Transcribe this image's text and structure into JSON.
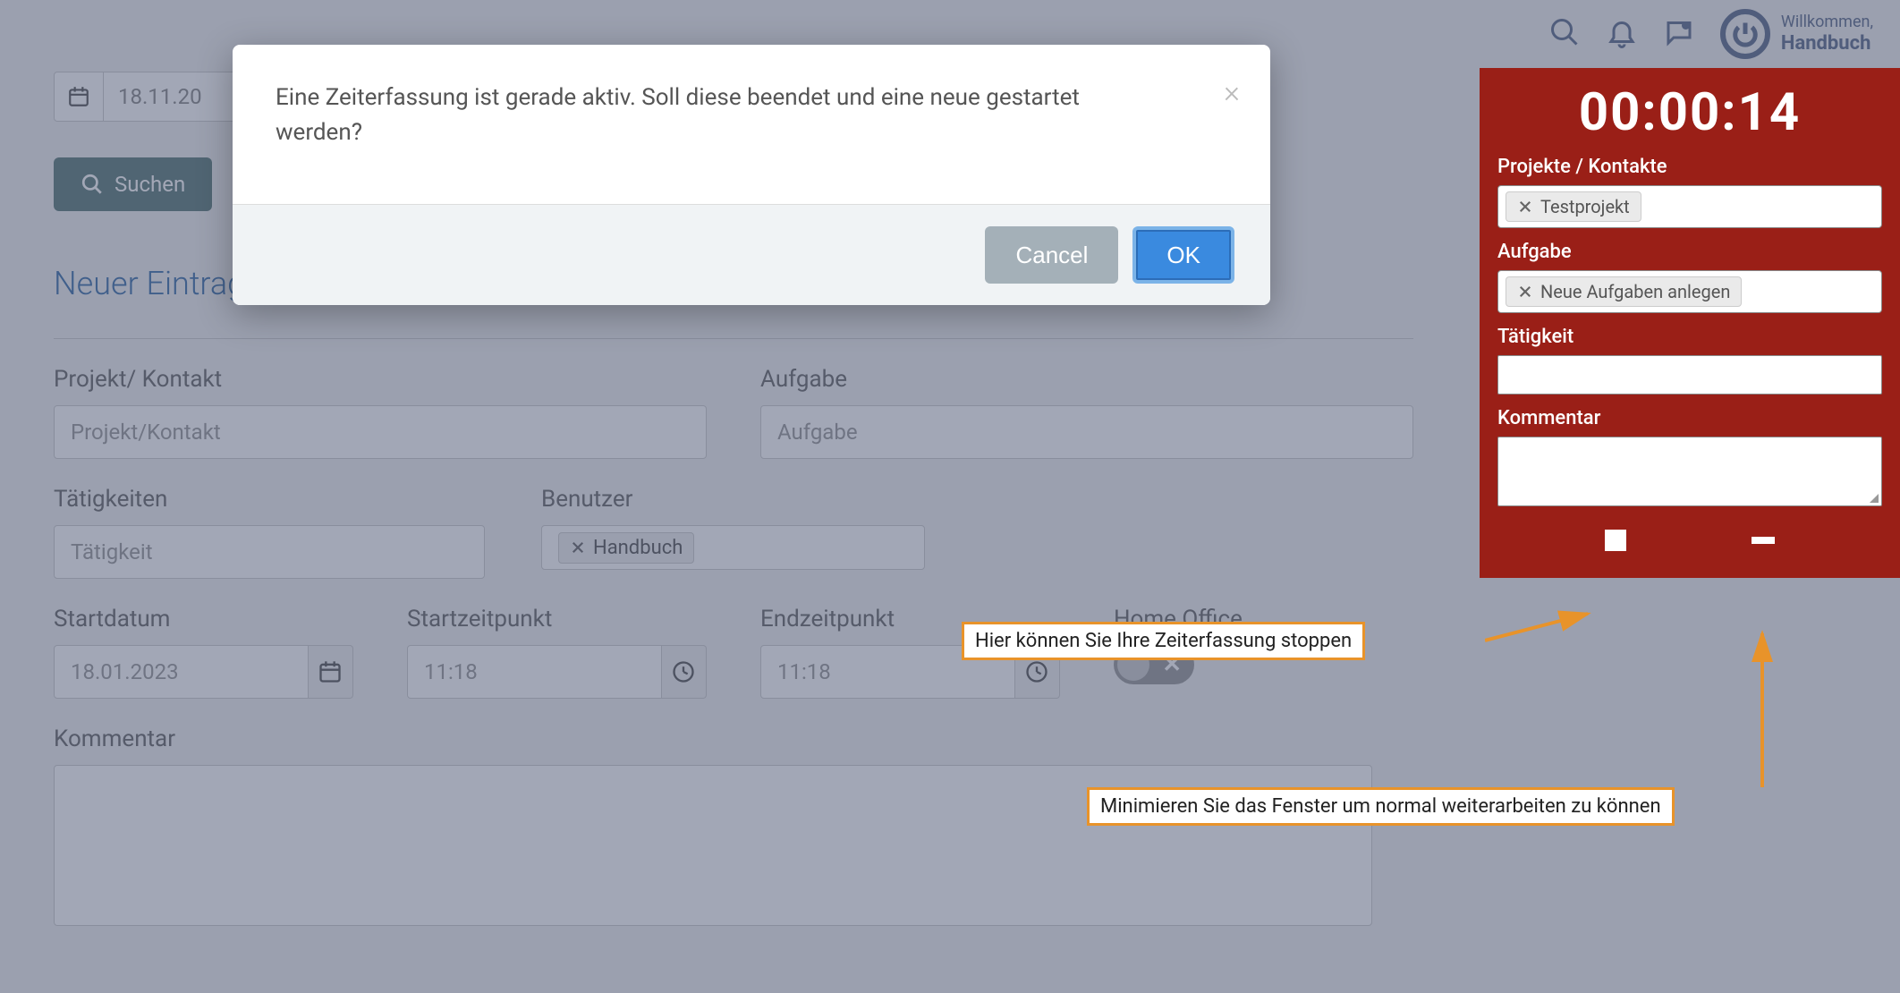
{
  "topbar": {
    "welcome_line1": "Willkommen,",
    "welcome_line2": "Handbuch"
  },
  "page": {
    "date_filter": "18.11.20",
    "search_button": "Suchen",
    "section_title": "Neuer Eintrag",
    "project_label": "Projekt/ Kontakt",
    "project_placeholder": "Projekt/Kontakt",
    "task_label": "Aufgabe",
    "task_placeholder": "Aufgabe",
    "activities_label": "Tätigkeiten",
    "activities_placeholder": "Tätigkeit",
    "user_label": "Benutzer",
    "user_tag": "Handbuch",
    "startdate_label": "Startdatum",
    "startdate_value": "18.01.2023",
    "starttime_label": "Startzeitpunkt",
    "starttime_value": "11:18",
    "endtime_label": "Endzeitpunkt",
    "endtime_value": "11:18",
    "homeoffice_label": "Home Office",
    "comment_label": "Kommentar"
  },
  "modal": {
    "message": "Eine Zeiterfassung ist gerade aktiv. Soll diese beendet und eine neue gestartet werden?",
    "cancel": "Cancel",
    "ok": "OK"
  },
  "timer": {
    "display": "00:00:14",
    "projects_label": "Projekte / Kontakte",
    "project_tag": "Testprojekt",
    "task_label": "Aufgabe",
    "task_tag": "Neue Aufgaben anlegen",
    "activity_label": "Tätigkeit",
    "comment_label": "Kommentar"
  },
  "callouts": {
    "stop": "Hier können Sie Ihre Zeiterfassung stoppen",
    "minimize": "Minimieren Sie das Fenster um normal weiterarbeiten zu können"
  }
}
